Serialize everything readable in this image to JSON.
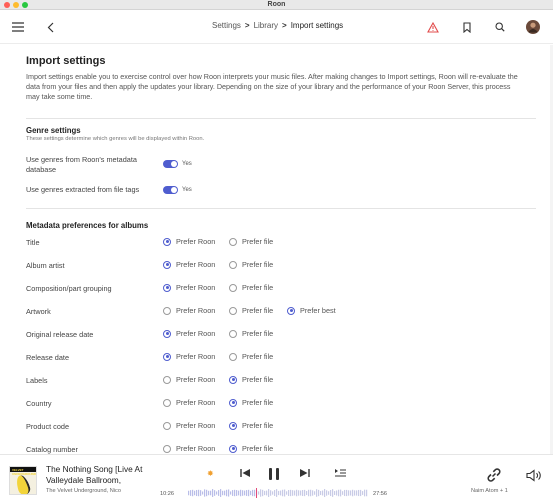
{
  "window": {
    "title": "Roon"
  },
  "toolbar": {
    "breadcrumb": [
      "Settings",
      "Library",
      "Import settings"
    ]
  },
  "colors": {
    "accent": "#4f5dcf",
    "alert": "#e24b4b",
    "warning_star": "#f0a030"
  },
  "icons": {
    "menu": "hamburger-menu-icon",
    "back": "chevron-left-icon",
    "alert": "alert-triangle-icon",
    "bookmark": "bookmark-icon",
    "search": "search-icon",
    "avatar": "profile-avatar"
  },
  "page": {
    "title": "Import settings",
    "description": "Import settings enable you to exercise control over how Roon interprets your music files. After making changes to Import settings, Roon will re-evaluate the data from your files and then apply the updates your library. Depending on the size of your library and the performance of your Roon Server, this process may take some time.",
    "genre": {
      "title": "Genre settings",
      "subtitle": "These settings determine which genres will be displayed within Roon.",
      "toggles": [
        {
          "label": "Use genres from Roon's metadata database",
          "value": "Yes",
          "on": true
        },
        {
          "label": "Use genres extracted from file tags",
          "value": "Yes",
          "on": true
        }
      ]
    },
    "metadata": {
      "title": "Metadata preferences for albums",
      "options": {
        "roon": "Prefer Roon",
        "file": "Prefer file",
        "best": "Prefer best"
      },
      "rows": [
        {
          "label": "Title",
          "selected": "roon"
        },
        {
          "label": "Album artist",
          "selected": "roon"
        },
        {
          "label": "Composition/part grouping",
          "selected": "roon"
        },
        {
          "label": "Artwork",
          "selected": "best"
        },
        {
          "label": "Original release date",
          "selected": "roon"
        },
        {
          "label": "Release date",
          "selected": "roon"
        },
        {
          "label": "Labels",
          "selected": "file"
        },
        {
          "label": "Country",
          "selected": "file"
        },
        {
          "label": "Product code",
          "selected": "file"
        },
        {
          "label": "Catalog number",
          "selected": "file"
        }
      ]
    }
  },
  "player": {
    "track_title": "The Nothing Song [Live At Valleydale Ballroom,",
    "artist": "The Velvet Underground, Nico",
    "elapsed": "10:26",
    "duration": "27:56",
    "progress": 0.373,
    "zone": "Naim Atom + 1",
    "cover_text": "VELVET UNDERGROUND"
  }
}
